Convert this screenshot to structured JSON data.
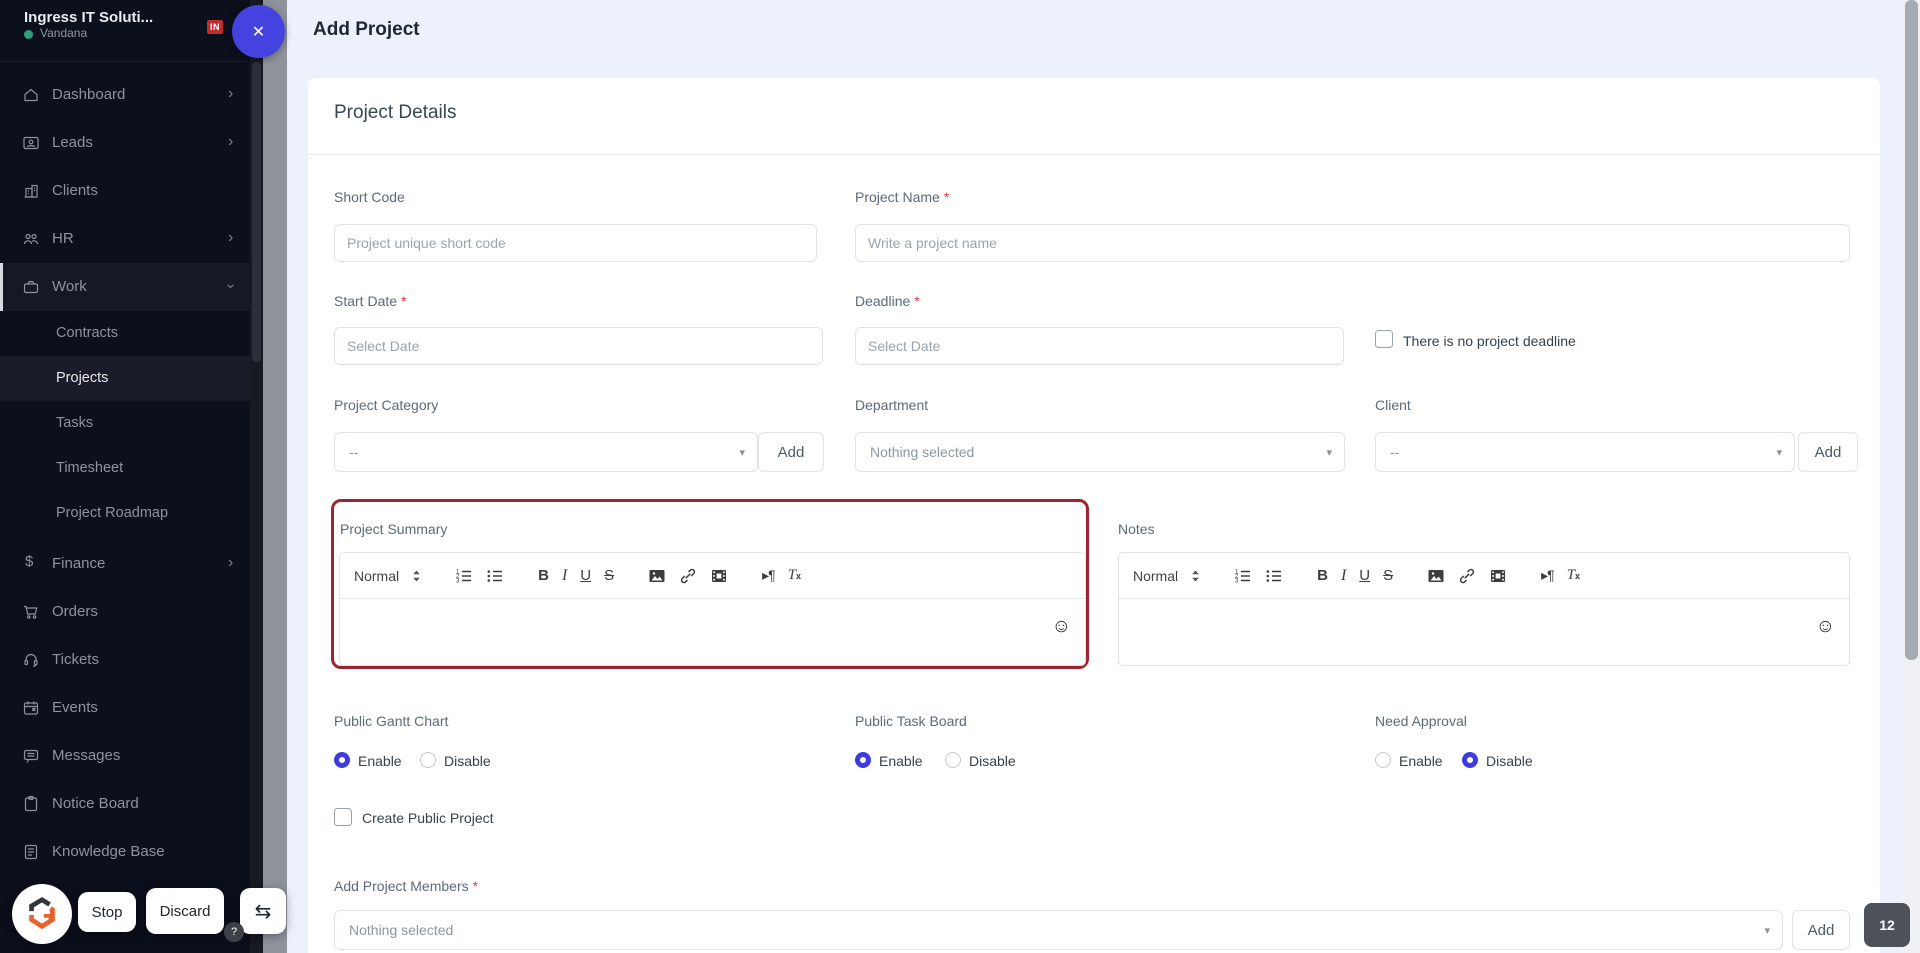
{
  "icons": {
    "chevron": "›",
    "close": "✕",
    "swap": "⇆",
    "caret": "▾",
    "emoji": "☺",
    "question": "?",
    "dollar": "$"
  },
  "colors": {
    "accent": "#4543df",
    "sidebar_bg": "#0c0f1c",
    "main_bg": "#edf1fb",
    "highlight_red": "#9c2531",
    "in_badge_red": "#bf2e2e",
    "online_green": "#2f9e7d"
  },
  "sidebar": {
    "company": "Ingress IT Soluti...",
    "user": "Vandana",
    "flag_badge": "IN",
    "items": [
      {
        "label": "Dashboard"
      },
      {
        "label": "Leads"
      },
      {
        "label": "Clients"
      },
      {
        "label": "HR"
      },
      {
        "label": "Work"
      }
    ],
    "submenu": [
      {
        "label": "Contracts"
      },
      {
        "label": "Projects"
      },
      {
        "label": "Tasks"
      },
      {
        "label": "Timesheet"
      },
      {
        "label": "Project Roadmap"
      }
    ],
    "items_lower": [
      {
        "label": "Finance"
      },
      {
        "label": "Orders"
      },
      {
        "label": "Tickets"
      },
      {
        "label": "Events"
      },
      {
        "label": "Messages"
      },
      {
        "label": "Notice Board"
      },
      {
        "label": "Knowledge Base"
      }
    ]
  },
  "header": {
    "title": "Add Project"
  },
  "card": {
    "title": "Project Details"
  },
  "form": {
    "required_marker": "*",
    "short_code": {
      "label": "Short Code",
      "placeholder": "Project unique short code"
    },
    "project_name": {
      "label": "Project Name",
      "placeholder": "Write a project name"
    },
    "start_date": {
      "label": "Start Date",
      "placeholder": "Select Date"
    },
    "deadline": {
      "label": "Deadline",
      "placeholder": "Select Date"
    },
    "no_deadline_checkbox": "There is no project deadline",
    "project_category": {
      "label": "Project Category",
      "value": "--",
      "add_label": "Add"
    },
    "department": {
      "label": "Department",
      "value": "Nothing selected"
    },
    "client": {
      "label": "Client",
      "value": "--",
      "add_label": "Add"
    },
    "project_summary": {
      "label": "Project Summary"
    },
    "notes": {
      "label": "Notes"
    },
    "editor": {
      "format_label": "Normal",
      "bold": "B",
      "italic": "I",
      "underline": "U",
      "strike": "S",
      "direction": "▸¶",
      "clean_t": "T",
      "clean_x": "x"
    },
    "public_gantt": {
      "label": "Public Gantt Chart",
      "enable": "Enable",
      "disable": "Disable",
      "selected": "enable"
    },
    "public_task_board": {
      "label": "Public Task Board",
      "enable": "Enable",
      "disable": "Disable",
      "selected": "enable"
    },
    "need_approval": {
      "label": "Need Approval",
      "enable": "Enable",
      "disable": "Disable",
      "selected": "disable"
    },
    "create_public_checkbox": "Create Public Project",
    "members": {
      "label": "Add Project Members",
      "value": "Nothing selected",
      "add_label": "Add"
    }
  },
  "overlay": {
    "stop": "Stop",
    "discard": "Discard",
    "badge_count": "12"
  }
}
